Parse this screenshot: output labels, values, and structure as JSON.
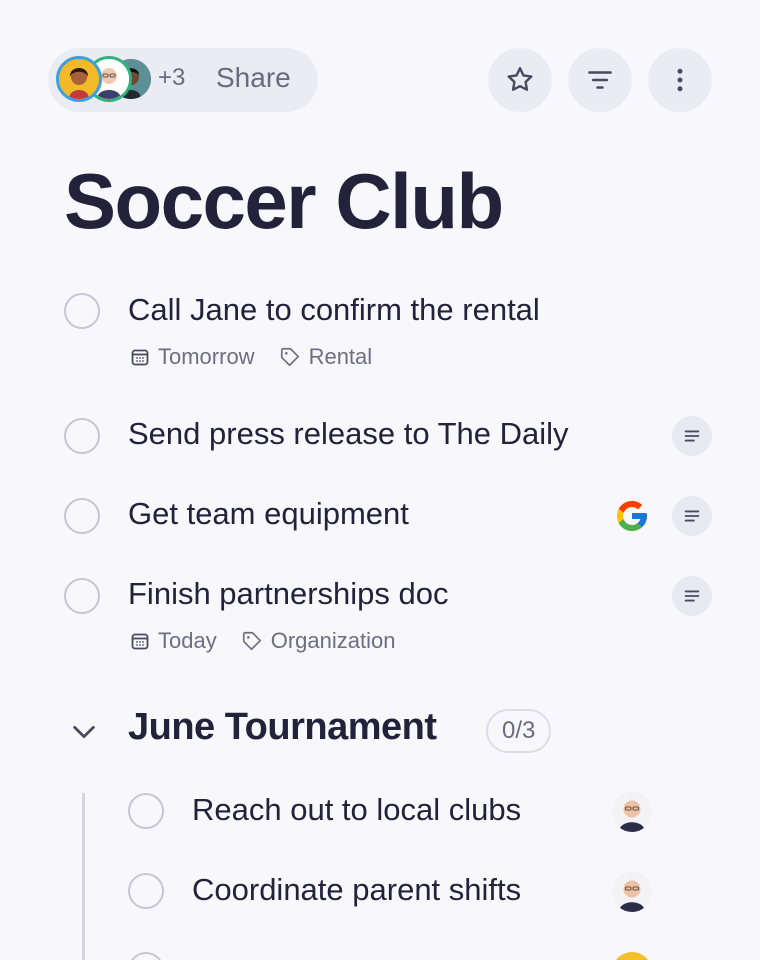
{
  "header": {
    "share_count": "+3",
    "share_label": "Share"
  },
  "title": "Soccer Club",
  "tasks": [
    {
      "text": "Call Jane to confirm the rental",
      "date": "Tomorrow",
      "tag": "Rental"
    },
    {
      "text": "Send press release to The Daily"
    },
    {
      "text": "Get team equipment"
    },
    {
      "text": "Finish partnerships doc",
      "date": "Today",
      "tag": "Organization"
    }
  ],
  "section": {
    "title": "June Tournament",
    "count": "0/3",
    "tasks": [
      {
        "text": "Reach out to local clubs"
      },
      {
        "text": "Coordinate parent shifts"
      }
    ]
  },
  "colors": {
    "background": "#f8f8fc",
    "text": "#23223a",
    "muted": "#6e6d82",
    "pill": "#ebebf3"
  }
}
